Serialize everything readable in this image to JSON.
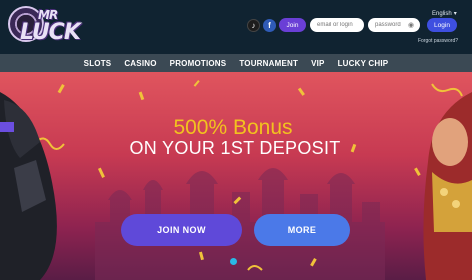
{
  "brand": {
    "logo_line1": "MR",
    "logo_line2": "LUCK"
  },
  "header": {
    "language": "English",
    "join_label": "Join",
    "email_placeholder": "email or login",
    "password_placeholder": "password",
    "login_label": "Login",
    "forgot_label": "Forgot password?"
  },
  "nav": {
    "items": [
      "SLOTS",
      "CASINO",
      "PROMOTIONS",
      "TOURNAMENT",
      "VIP",
      "LUCKY CHIP"
    ]
  },
  "hero": {
    "headline": "500% Bonus",
    "subheadline": "ON YOUR 1ST DEPOSIT",
    "join_now_label": "JOIN NOW",
    "more_label": "MORE"
  },
  "colors": {
    "header_bg": "#102331",
    "nav_bg": "#3b4954",
    "headline": "#f2c21f",
    "join_now": "#5f49d9",
    "more": "#4b79e8",
    "login": "#3e4fe0"
  }
}
